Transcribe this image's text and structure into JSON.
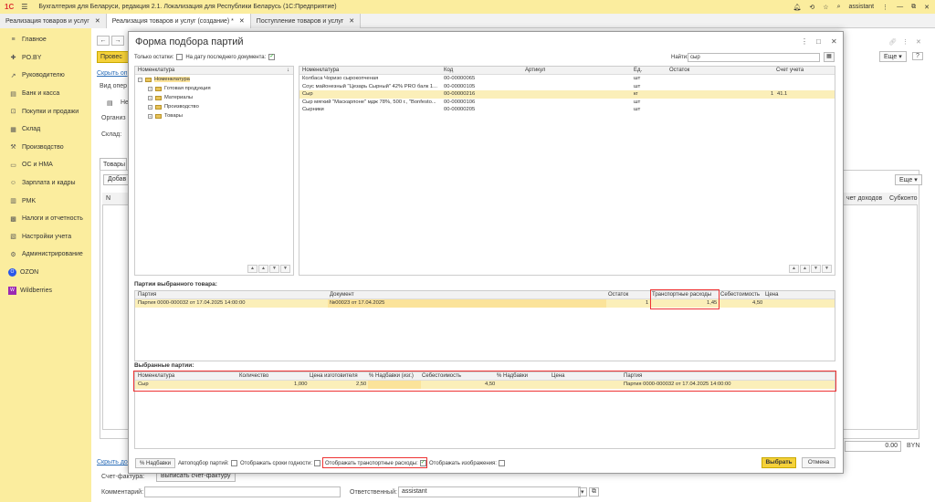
{
  "app": {
    "logo": "1С",
    "title": "Бухгалтерия для Беларуси, редакция 2.1. Локализация для Республики Беларусь   (1С:Предприятие)",
    "user": "assistant"
  },
  "tabs": [
    {
      "label": "Реализация товаров и услуг"
    },
    {
      "label": "Реализация товаров и услуг (создание) *"
    },
    {
      "label": "Поступление товаров и услуг"
    }
  ],
  "sidebar": {
    "items": [
      {
        "label": "Главное",
        "icon": "≡"
      },
      {
        "label": "PO.BY",
        "icon": "✚"
      },
      {
        "label": "Руководителю",
        "icon": "↗"
      },
      {
        "label": "Банк и касса",
        "icon": "▤"
      },
      {
        "label": "Покупки и продажи",
        "icon": "⊡"
      },
      {
        "label": "Склад",
        "icon": "▦"
      },
      {
        "label": "Производство",
        "icon": "⚒"
      },
      {
        "label": "ОС и НМА",
        "icon": "▭"
      },
      {
        "label": "Зарплата и кадры",
        "icon": "☺"
      },
      {
        "label": "PMK",
        "icon": "▥"
      },
      {
        "label": "Налоги и отчетность",
        "icon": "▩"
      },
      {
        "label": "Настройки учета",
        "icon": "▧"
      },
      {
        "label": "Администрирование",
        "icon": "⚙"
      },
      {
        "label": "OZON",
        "icon": "O"
      },
      {
        "label": "Wildberries",
        "icon": "W"
      }
    ]
  },
  "background": {
    "post_label": "Провес",
    "hide_link": "Скрыть оп",
    "vid_oper": "Вид опер",
    "ne": "Не",
    "org": "Организ",
    "sklad": "Склад:",
    "goods_tab": "Товары",
    "add_btn": "Добав",
    "eshe": "Еще",
    "col_n": "N",
    "col_schet_dohodov": "чет доходов",
    "col_subkonto": "Субконто",
    "total": "0.00",
    "currency": "BYN",
    "hide_link2": "Скрыть до",
    "invoice_lbl": "Счет-фактура:",
    "invoice_btn": "Выписать счет-фактуру",
    "comment_lbl": "Комментарий:",
    "resp_lbl": "Ответственный:",
    "resp_value": "assistant"
  },
  "modal": {
    "title": "Форма подбора партий",
    "only_rest": "Только остатки:",
    "on_date": "На дату последнего документа:",
    "find_lbl": "Найти:",
    "find_value": "сыр",
    "tree": {
      "header": "Номенклатура",
      "items": [
        {
          "label": "Номенклатура",
          "level": 0,
          "sel": true
        },
        {
          "label": "Готовая продукция",
          "level": 1
        },
        {
          "label": "Материалы",
          "level": 1
        },
        {
          "label": "Производство",
          "level": 1
        },
        {
          "label": "Товары",
          "level": 1
        }
      ]
    },
    "items_table": {
      "headers": [
        "Номенклатура",
        "Код",
        "Артикул",
        "Ед.",
        "Остаток",
        "Счет учета"
      ],
      "rows": [
        {
          "name": "Колбаса Чоризо сырокопченая",
          "code": "00-00000065",
          "art": "",
          "unit": "шт",
          "rest": "",
          "acc": ""
        },
        {
          "name": "Соус майонезный \"Цезарь Сырный\" 42% PRO балк 1...",
          "code": "00-00000105",
          "art": "",
          "unit": "шт",
          "rest": "",
          "acc": ""
        },
        {
          "name": "Сыр",
          "code": "00-00000216",
          "art": "",
          "unit": "кг",
          "rest": "1",
          "acc": "41.1",
          "sel": true
        },
        {
          "name": "Сыр мягкий \"Маскарпоне\" мдж 78%, 500 г., \"Bonfesto...",
          "code": "00-00000106",
          "art": "",
          "unit": "шт",
          "rest": "",
          "acc": ""
        },
        {
          "name": "Сырники",
          "code": "00-00000205",
          "art": "",
          "unit": "шт",
          "rest": "",
          "acc": ""
        }
      ]
    },
    "lots_section": "Партии выбранного товара:",
    "lots_table": {
      "headers": [
        "Партия",
        "Документ",
        "Остаток",
        "Транспортные расходы",
        "Себестоимость",
        "Цена"
      ],
      "row": {
        "lot": "Партия 0000-000032 от 17.04.2025 14:00:00",
        "doc": "№00023 от 17.04.2025",
        "rest": "1",
        "transport": "1,45",
        "cost": "4,50",
        "price": ""
      }
    },
    "selected_section": "Выбранные партии:",
    "selected_table": {
      "headers": [
        "Номенклатура",
        "Количество",
        "Цена изготовителя",
        "% Надбавки (изг.)",
        "Себестоимость",
        "% Надбавки",
        "Цена",
        "Партия"
      ],
      "row": {
        "name": "Сыр",
        "qty": "1,000",
        "mfr_price": "2,50",
        "markup_mfr": "",
        "cost": "4,50",
        "markup": "",
        "price": "",
        "lot": "Партия 0000-000032 от 17.04.2025 14:00:00"
      }
    },
    "footer": {
      "markup_btn": "% Надбавки",
      "auto_lbl": "Автоподбор партий:",
      "expiry_lbl": "Отображать сроки годности:",
      "transport_lbl": "Отображать транспортные расходы:",
      "images_lbl": "Отображать изображения:",
      "select_btn": "Выбрать",
      "cancel_btn": "Отмена"
    }
  }
}
